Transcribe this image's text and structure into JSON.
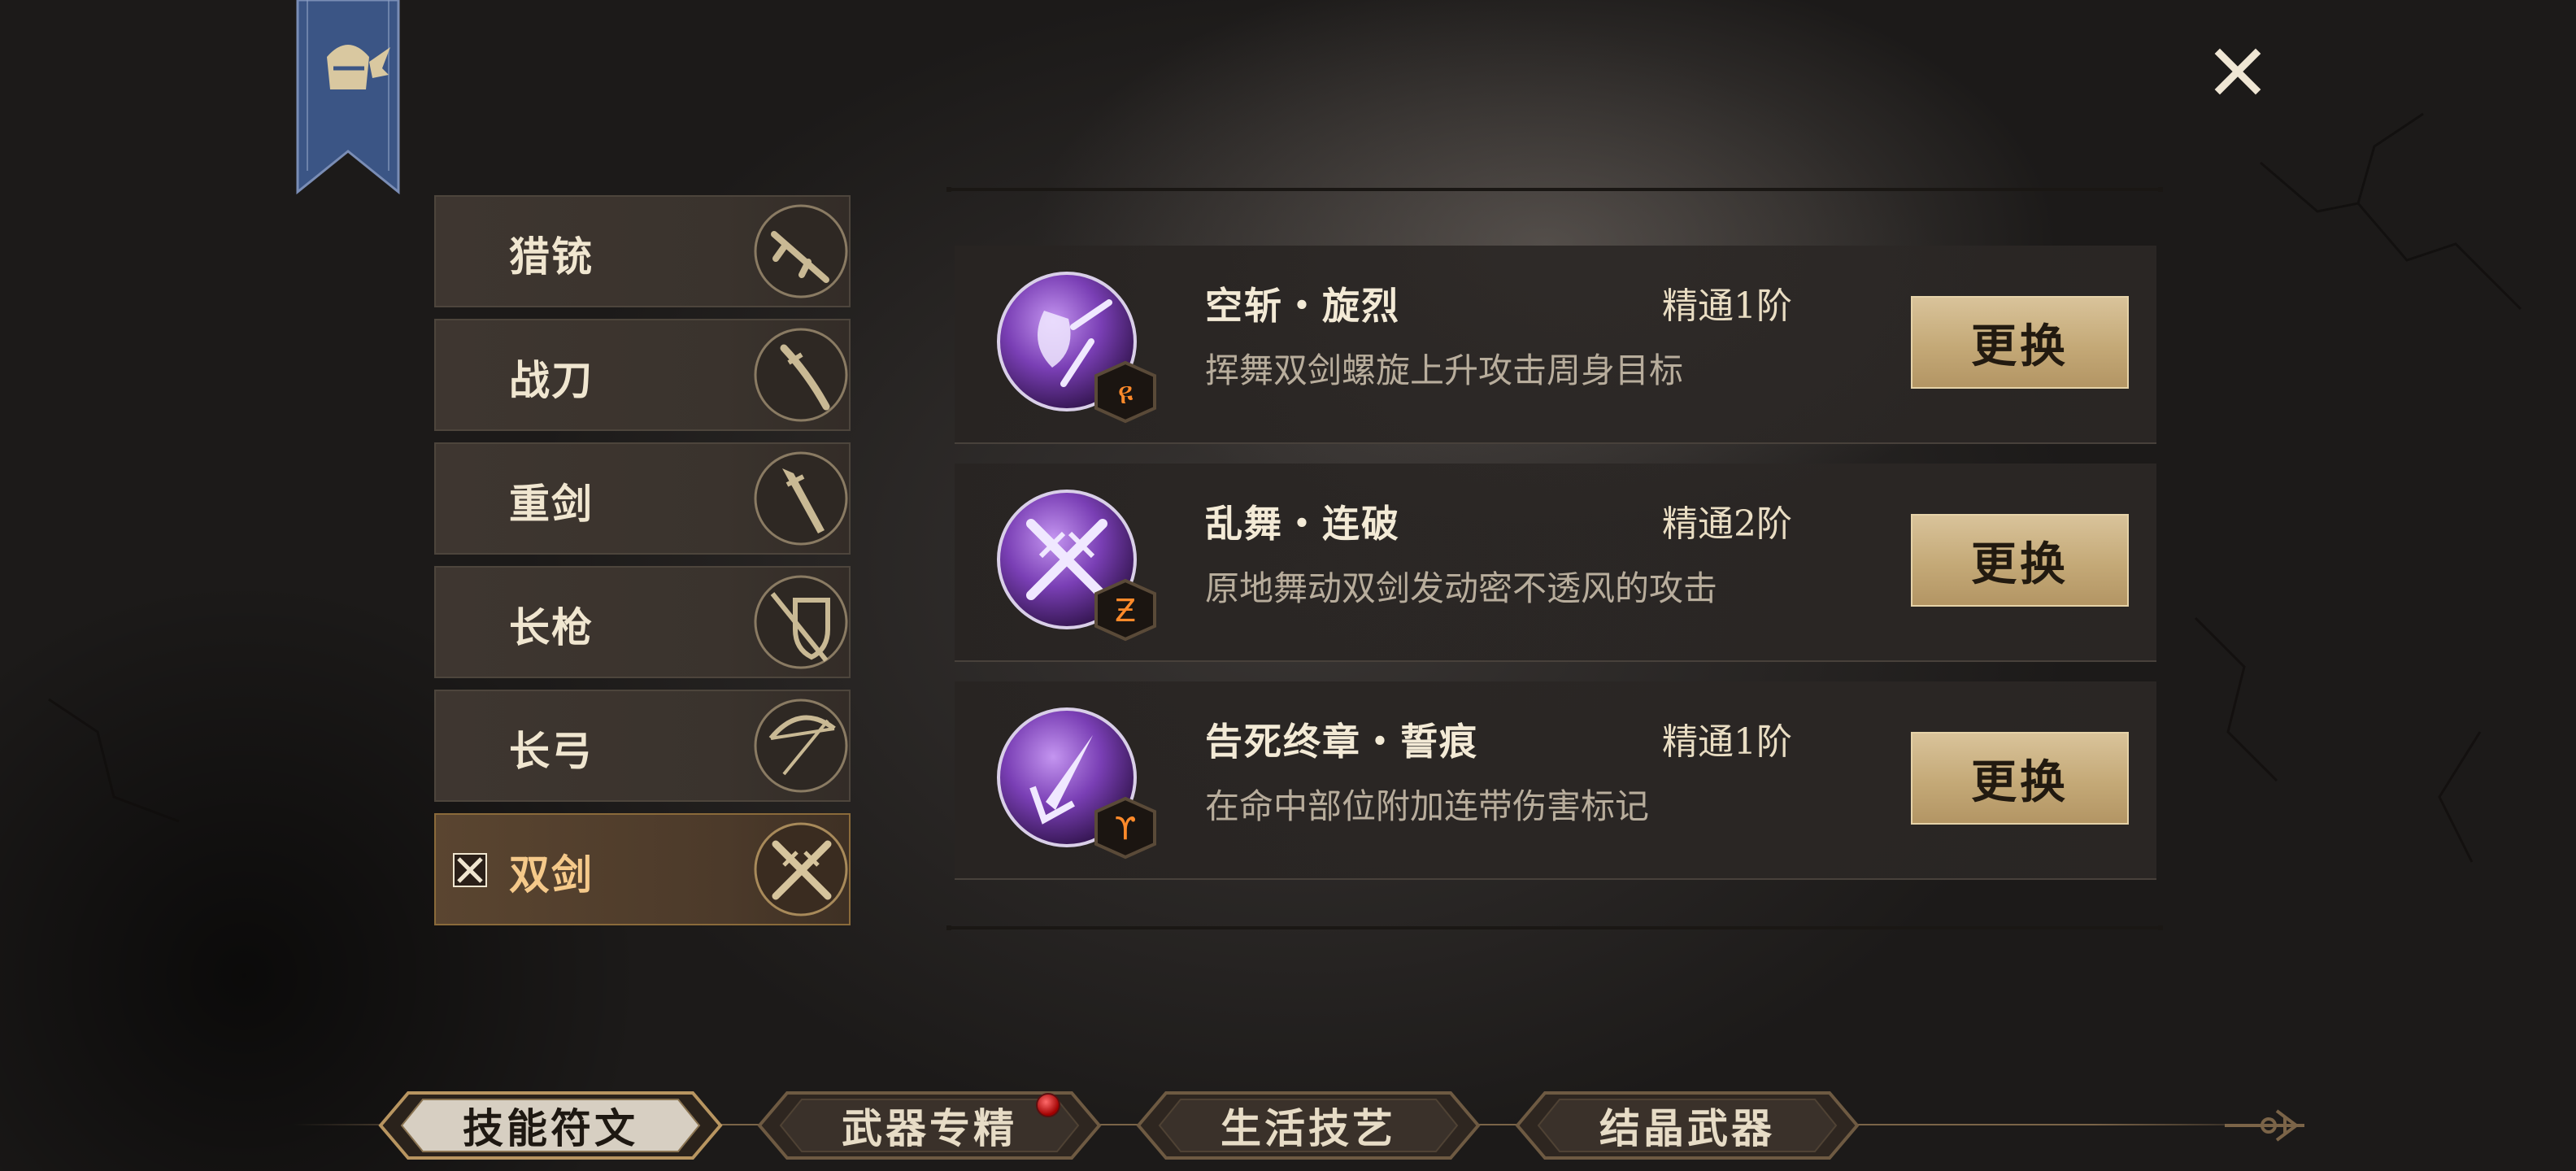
{
  "close_button": {
    "icon": "close-icon"
  },
  "banner": {
    "icon": "winged-helmet-icon",
    "color": "#3c5a8c"
  },
  "weapons": [
    {
      "label": "猎铳",
      "icon": "musket-icon"
    },
    {
      "label": "战刀",
      "icon": "saber-icon"
    },
    {
      "label": "重剑",
      "icon": "greatsword-icon"
    },
    {
      "label": "长枪",
      "icon": "spear-shield-icon"
    },
    {
      "label": "长弓",
      "icon": "longbow-icon"
    },
    {
      "label": "双剑",
      "icon": "dual-swords-icon",
      "selected": true
    }
  ],
  "skills": [
    {
      "name": "空斩・旋烈",
      "level": "精通1阶",
      "desc": "挥舞双剑螺旋上升攻击周身目标",
      "button": "更换",
      "rune_glyph": "ዩ"
    },
    {
      "name": "乱舞・连破",
      "level": "精通2阶",
      "desc": "原地舞动双剑发动密不透风的攻击",
      "button": "更换",
      "rune_glyph": "Ƶ"
    },
    {
      "name": "告死终章・誓痕",
      "level": "精通1阶",
      "desc": "在命中部位附加连带伤害标记",
      "button": "更换",
      "rune_glyph": "ϒ"
    }
  ],
  "tabs": [
    {
      "label": "技能符文",
      "active": true
    },
    {
      "label": "武器专精",
      "badge": true
    },
    {
      "label": "生活技艺"
    },
    {
      "label": "结晶武器"
    }
  ],
  "colors": {
    "accent_gold": "#c4a977",
    "selected_text": "#f5c98a",
    "badge_red": "#c01010",
    "orb_purple": "#7a3fb5"
  }
}
